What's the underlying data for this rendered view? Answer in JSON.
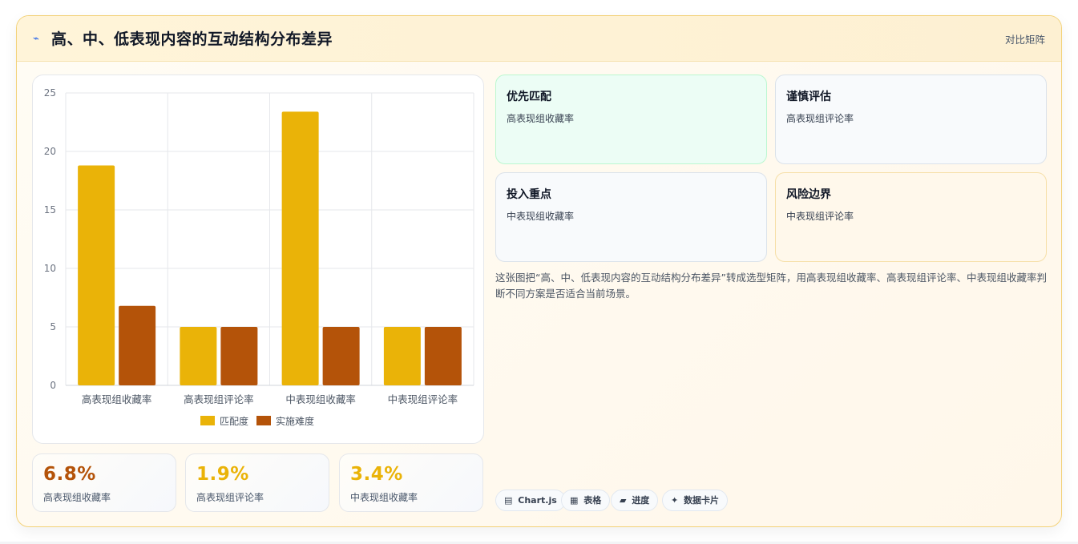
{
  "header": {
    "title": "高、中、低表现内容的互动结构分布差异",
    "tag": "对比矩阵",
    "icon": "sparkline-icon"
  },
  "chart_data": {
    "type": "bar",
    "categories": [
      "高表现组收藏率",
      "高表现组评论率",
      "中表现组收藏率",
      "中表现组评论率"
    ],
    "series": [
      {
        "name": "匹配度",
        "values": [
          18.8,
          5,
          23.4,
          5
        ],
        "color": "#eab308"
      },
      {
        "name": "实施难度",
        "values": [
          6.8,
          5,
          5,
          5
        ],
        "color": "#b45309"
      }
    ],
    "ylim": [
      0,
      25
    ],
    "yticks": [
      0,
      5,
      10,
      15,
      20,
      25
    ],
    "grid": true,
    "legend": "bottom"
  },
  "stats": [
    {
      "value": "6.8%",
      "label": "高表现组收藏率",
      "color": "#b45309"
    },
    {
      "value": "1.9%",
      "label": "高表现组评论率",
      "color": "#eab308"
    },
    {
      "value": "3.4%",
      "label": "中表现组收藏率",
      "color": "#eab308"
    }
  ],
  "matrix": [
    {
      "title": "优先匹配",
      "sub": "高表现组收藏率",
      "bg": "#ecfdf5",
      "border": "#bbf7d0"
    },
    {
      "title": "谨慎评估",
      "sub": "高表现组评论率",
      "bg": "#f8fafc",
      "border": "#dbe2ea"
    },
    {
      "title": "投入重点",
      "sub": "中表现组收藏率",
      "bg": "#f8fafc",
      "border": "#dbe2ea"
    },
    {
      "title": "风险边界",
      "sub": "中表现组评论率",
      "bg": "#fff8eb",
      "border": "#f6dfa8"
    }
  ],
  "description": "这张图把“高、中、低表现内容的互动结构分布差异”转成选型矩阵，用高表现组收藏率、高表现组评论率、中表现组收藏率判断不同方案是否适合当前场景。",
  "chips": [
    {
      "icon": "chart-icon",
      "glyph": "▤",
      "label": "Chart.js"
    },
    {
      "icon": "table-icon",
      "glyph": "▦",
      "label": "表格"
    },
    {
      "icon": "progress-icon",
      "glyph": "▰",
      "label": "进度"
    },
    {
      "icon": "data-card-icon",
      "glyph": "✦",
      "label": "数据卡片"
    }
  ]
}
